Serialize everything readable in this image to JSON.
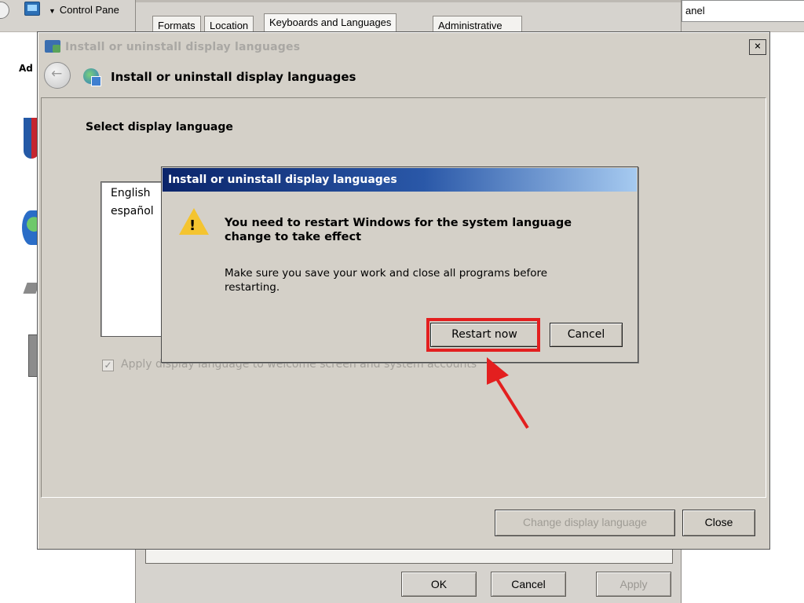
{
  "background_window": {
    "breadcrumb": "Control Pane",
    "search_box_text": "anel",
    "tabs": [
      {
        "label": "Formats"
      },
      {
        "label": "Location"
      },
      {
        "label": "Keyboards and Languages"
      },
      {
        "label": "Administrative"
      }
    ],
    "left_heading": "Ad",
    "buttons": {
      "ok": "OK",
      "cancel": "Cancel",
      "apply": "Apply"
    }
  },
  "language_dialog": {
    "title": "Install or uninstall display languages",
    "header": "Install or uninstall display languages",
    "section_label": "Select display language",
    "languages": [
      "English",
      "español"
    ],
    "checkbox": {
      "label": "Apply display language to welcome screen and system accounts",
      "checked": true,
      "enabled": false
    },
    "buttons": {
      "change": "Change display language",
      "close": "Close"
    },
    "close_glyph": "×"
  },
  "message_box": {
    "title": "Install or uninstall display languages",
    "icon": "warning-icon",
    "main_text": "You need to restart Windows for the system language change to take effect",
    "sub_text": "Make sure you save your work and close all programs before restarting.",
    "warning_glyph": "!",
    "buttons": {
      "restart": "Restart now",
      "cancel": "Cancel"
    }
  },
  "annotation": {
    "highlight_color": "#e31f1f",
    "arrow_color": "#e31f1f",
    "target": "restart-now-button"
  }
}
